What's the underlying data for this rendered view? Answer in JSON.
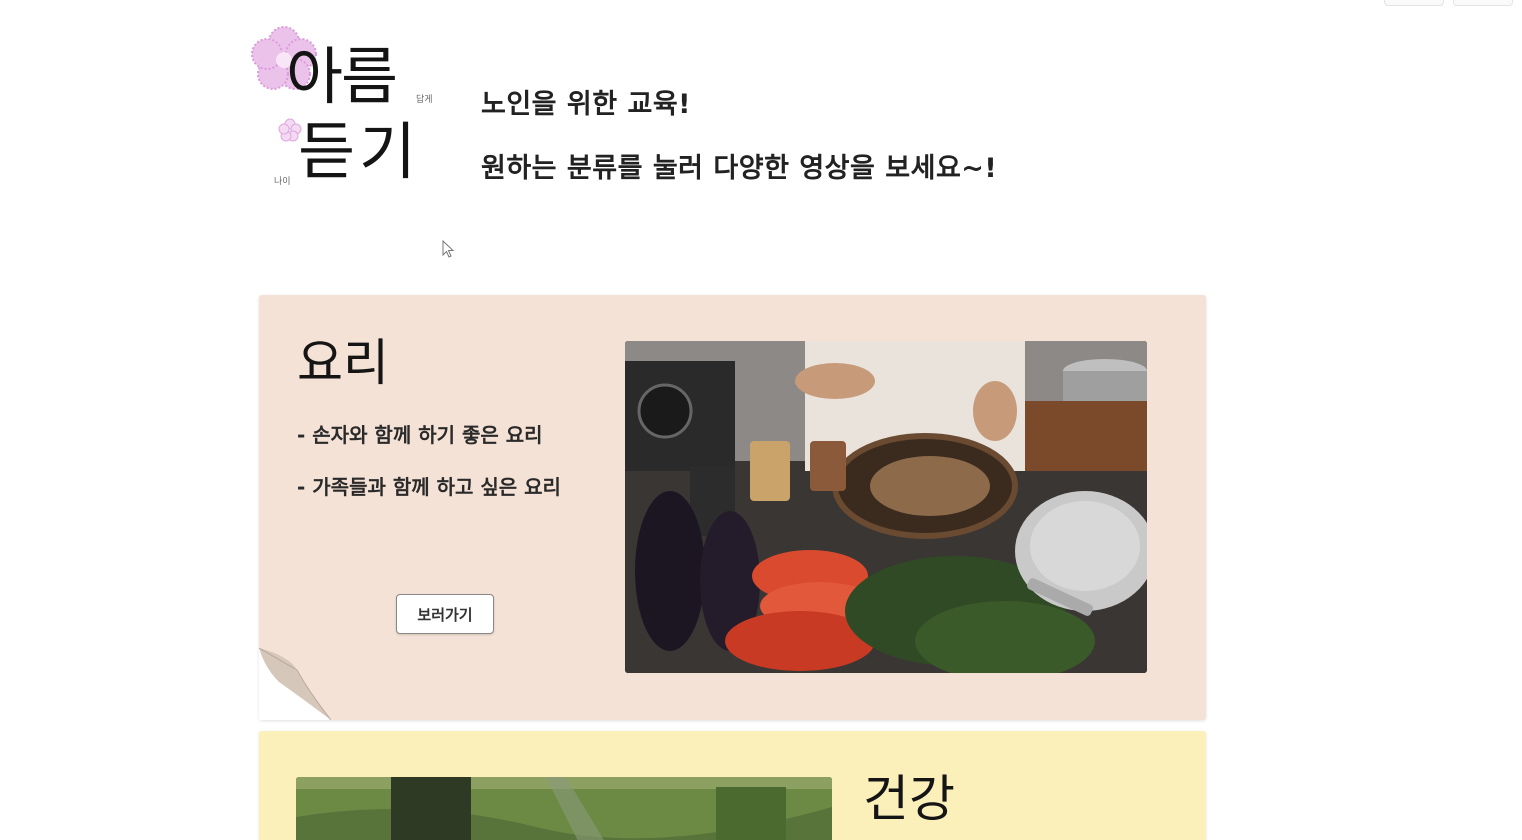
{
  "header": {
    "logo": {
      "line1": "아름",
      "line2": "듣기",
      "small_right": "답게",
      "small_left": "나이"
    },
    "taglines": [
      "노인을 위한 교육!",
      "원하는 분류를 눌러 다양한 영상을 보세요~!"
    ]
  },
  "categories": {
    "cooking": {
      "title": "요리",
      "items": [
        "- 손자와 함께 하기 좋은 요리",
        "- 가족들과 함께 하고 싶은 요리"
      ],
      "button_label": "보러가기",
      "background": "#f4e2d6"
    },
    "health": {
      "title": "건강",
      "background": "#fbefba"
    }
  },
  "icons": {
    "logo_flower": "flower-icon",
    "cursor": "mouse-cursor-icon"
  }
}
